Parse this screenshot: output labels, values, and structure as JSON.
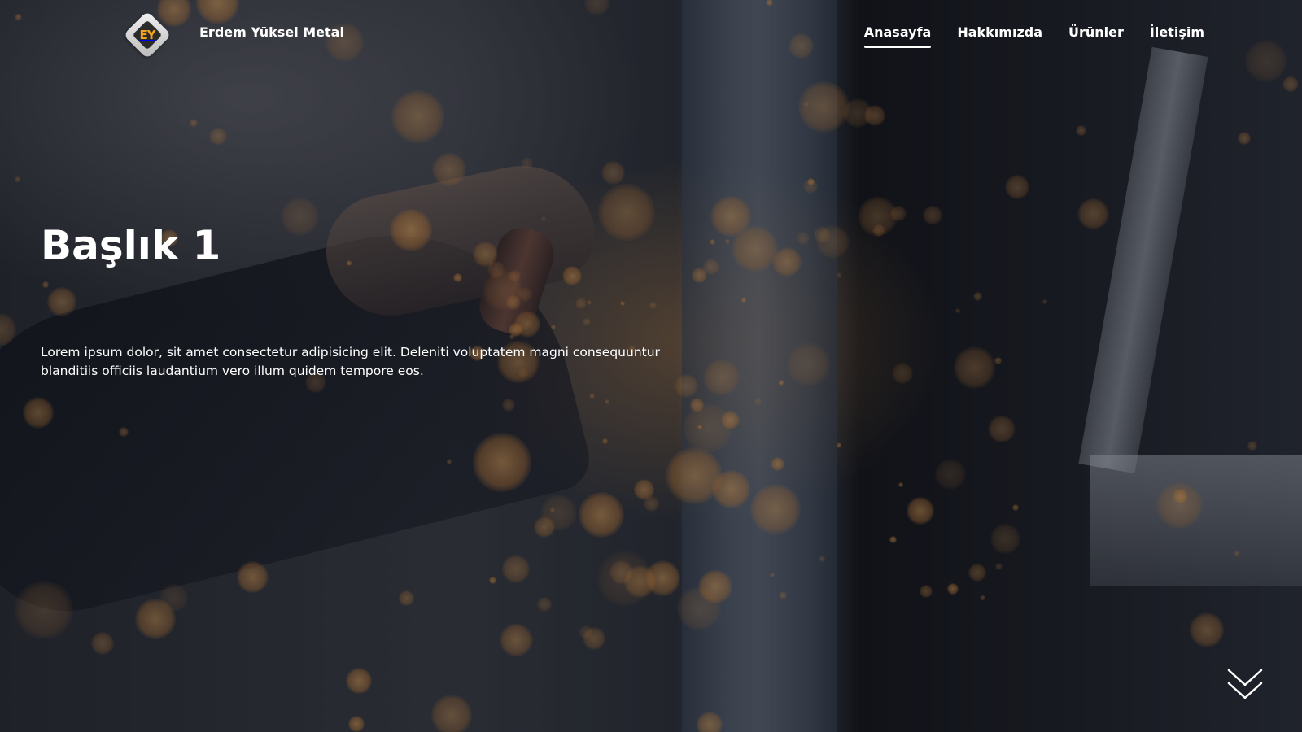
{
  "header": {
    "logo_text": "EY",
    "brand_name": "Erdem Yüksel Metal"
  },
  "nav": {
    "items": [
      {
        "label": "Anasayfa",
        "active": true
      },
      {
        "label": "Hakkımızda",
        "active": false
      },
      {
        "label": "Ürünler",
        "active": false
      },
      {
        "label": "İletişim",
        "active": false
      }
    ]
  },
  "hero": {
    "title": "Başlık 1",
    "description": "Lorem ipsum dolor, sit amet consectetur adipisicing elit. Deleniti voluptatem magni consequuntur blanditiis officiis laudantium vero illum quidem tempore eos.",
    "scroll_icon": "double-chevron-down-icon"
  },
  "colors": {
    "text": "#ffffff",
    "logo_accent": "#f7a21b",
    "spark": "#f0a050"
  }
}
